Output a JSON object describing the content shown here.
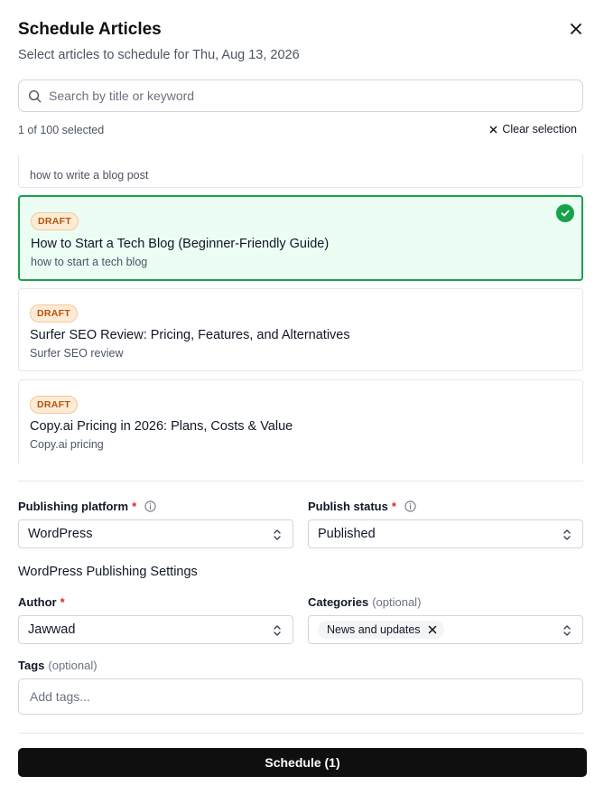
{
  "dialog": {
    "title": "Schedule Articles",
    "subtitle": "Select articles to schedule for Thu, Aug 13, 2026"
  },
  "search": {
    "placeholder": "Search by title or keyword",
    "value": ""
  },
  "selection": {
    "count_text": "1 of 100 selected",
    "clear_label": "Clear selection"
  },
  "articles": [
    {
      "status": "",
      "title": "",
      "keyword": "how to write a blog post",
      "selected": false
    },
    {
      "status": "DRAFT",
      "title": "How to Start a Tech Blog (Beginner-Friendly Guide)",
      "keyword": "how to start a tech blog",
      "selected": true
    },
    {
      "status": "DRAFT",
      "title": "Surfer SEO Review: Pricing, Features, and Alternatives",
      "keyword": "Surfer SEO review",
      "selected": false
    },
    {
      "status": "DRAFT",
      "title": "Copy.ai Pricing in 2026: Plans, Costs & Value",
      "keyword": "Copy.ai pricing",
      "selected": false
    }
  ],
  "form": {
    "platform": {
      "label": "Publishing platform",
      "required": "*",
      "value": "WordPress"
    },
    "status": {
      "label": "Publish status",
      "required": "*",
      "value": "Published"
    },
    "section_title": "WordPress Publishing Settings",
    "author": {
      "label": "Author",
      "required": "*",
      "value": "Jawwad"
    },
    "categories": {
      "label": "Categories",
      "optional": "(optional)",
      "chips": [
        "News and updates"
      ]
    },
    "tags": {
      "label": "Tags",
      "optional": "(optional)",
      "placeholder": "Add tags...",
      "value": ""
    }
  },
  "action": {
    "schedule_label": "Schedule (1)"
  },
  "colors": {
    "accent": "#16a34a",
    "selected_bg": "#ecfdf3",
    "draft_text": "#b45309",
    "draft_bg": "#fdebd6",
    "required": "#dc2626",
    "primary_btn": "#0f0f10"
  },
  "icons": {
    "close": "close-icon",
    "search": "search-icon",
    "info": "info-icon",
    "chevrons": "chevron-up-down-icon",
    "check": "check-circle-icon",
    "remove_chip": "x-icon"
  }
}
